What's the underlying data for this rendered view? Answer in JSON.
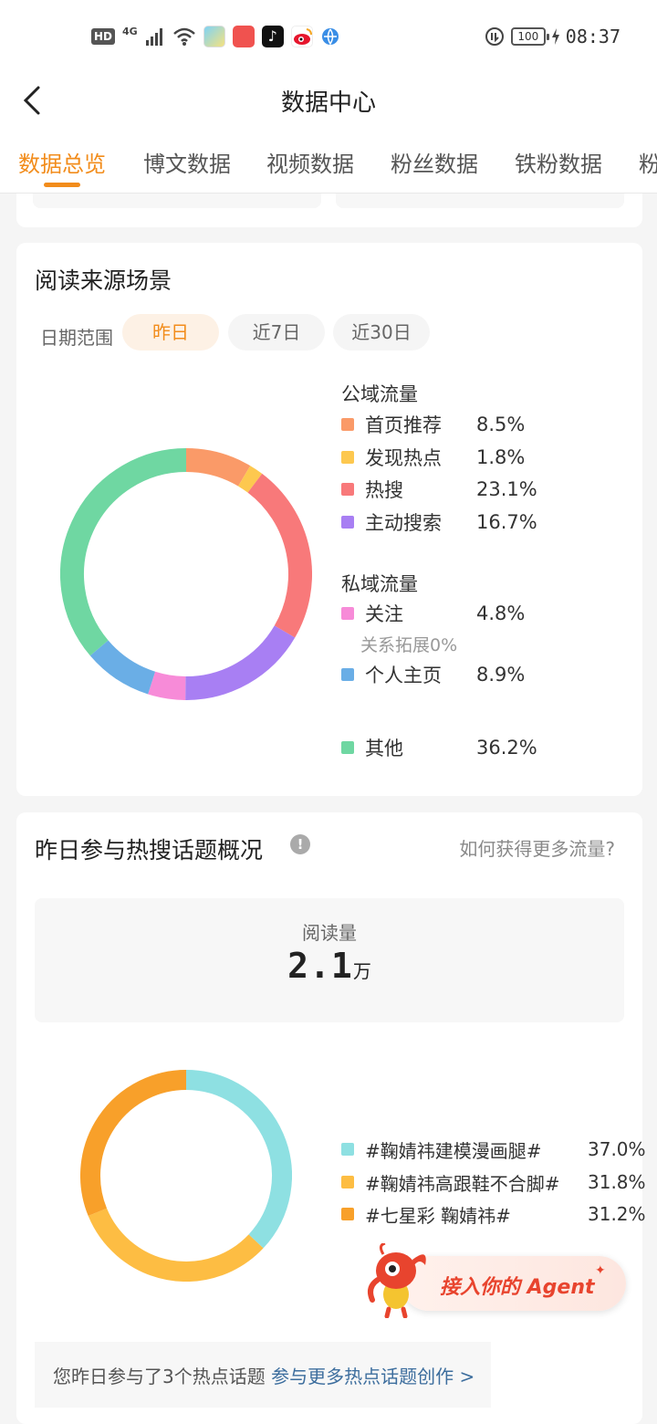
{
  "status_bar": {
    "hd": "HD",
    "network": "4G",
    "battery": "100",
    "time": "08:37"
  },
  "header": {
    "title": "数据中心"
  },
  "tabs": [
    "数据总览",
    "博文数据",
    "视频数据",
    "粉丝数据",
    "铁粉数据",
    "粉"
  ],
  "active_tab_index": 0,
  "read_source": {
    "title": "阅读来源场景",
    "date_label": "日期范围",
    "ranges": [
      "昨日",
      "近7日",
      "近30日"
    ],
    "active_range": "昨日",
    "public_title": "公域流量",
    "private_title": "私域流量",
    "relation_note": "关系拓展0%",
    "items": [
      {
        "name": "首页推荐",
        "value": "8.5%",
        "pct": 8.5,
        "color": "#fa9a68",
        "group": "public"
      },
      {
        "name": "发现热点",
        "value": "1.8%",
        "pct": 1.8,
        "color": "#fdc84f",
        "group": "public"
      },
      {
        "name": "热搜",
        "value": "23.1%",
        "pct": 23.1,
        "color": "#f8797a",
        "group": "public"
      },
      {
        "name": "主动搜索",
        "value": "16.7%",
        "pct": 16.7,
        "color": "#a87ff3",
        "group": "public"
      },
      {
        "name": "关注",
        "value": "4.8%",
        "pct": 4.8,
        "color": "#f78bd8",
        "group": "private"
      },
      {
        "name": "个人主页",
        "value": "8.9%",
        "pct": 8.9,
        "color": "#6aaee6",
        "group": "private"
      },
      {
        "name": "其他",
        "value": "36.2%",
        "pct": 36.2,
        "color": "#6fd7a2",
        "group": "other"
      }
    ]
  },
  "hot_topics": {
    "title": "昨日参与热搜话题概况",
    "help_link": "如何获得更多流量?",
    "metric_label": "阅读量",
    "metric_value": "2.1",
    "metric_unit": "万",
    "items": [
      {
        "name": "#鞠婧祎建模漫画腿#",
        "value": "37.0%",
        "pct": 37.0,
        "color": "#8ee0e2"
      },
      {
        "name": "#鞠婧祎高跟鞋不合脚#",
        "value": "31.8%",
        "pct": 31.8,
        "color": "#fdbd43"
      },
      {
        "name": "#七星彩 鞠婧祎#",
        "value": "31.2%",
        "pct": 31.2,
        "color": "#f8a02a"
      }
    ],
    "note_text": "您昨日参与了3个热点话题 ",
    "note_link": "参与更多热点话题创作 >"
  },
  "agent": {
    "label": "接入你的 Agent",
    "sparkle": "✦"
  },
  "colors": {
    "accent": "#f28c1b",
    "link": "#3d6e9e",
    "agent": "#e8442e"
  }
}
